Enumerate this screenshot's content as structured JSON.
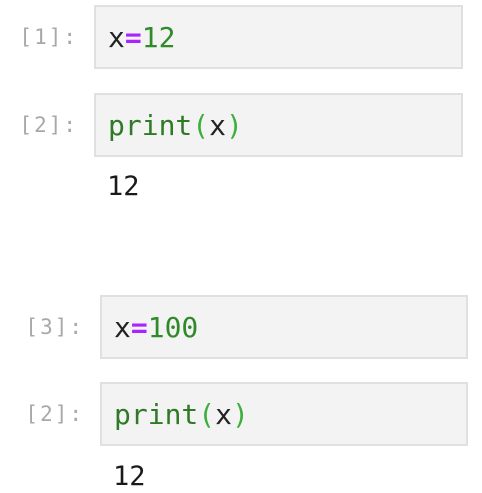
{
  "cells": [
    {
      "prompt": "[1]:",
      "code": {
        "var": "x",
        "op": "=",
        "num": "12"
      }
    },
    {
      "prompt": "[2]:",
      "code": {
        "fn": "print",
        "open": "(",
        "arg": "x",
        "close": ")"
      },
      "output": "12"
    },
    {
      "prompt": "[3]:",
      "code": {
        "var": "x",
        "op": "=",
        "num": "100"
      }
    },
    {
      "prompt": "[2]:",
      "code": {
        "fn": "print",
        "open": "(",
        "arg": "x",
        "close": ")"
      },
      "output": "12"
    }
  ],
  "colors": {
    "operator": "#aa22ff",
    "number": "#2f8a2a",
    "builtin": "#2f7a26",
    "prompt": "#a8a8a8"
  }
}
